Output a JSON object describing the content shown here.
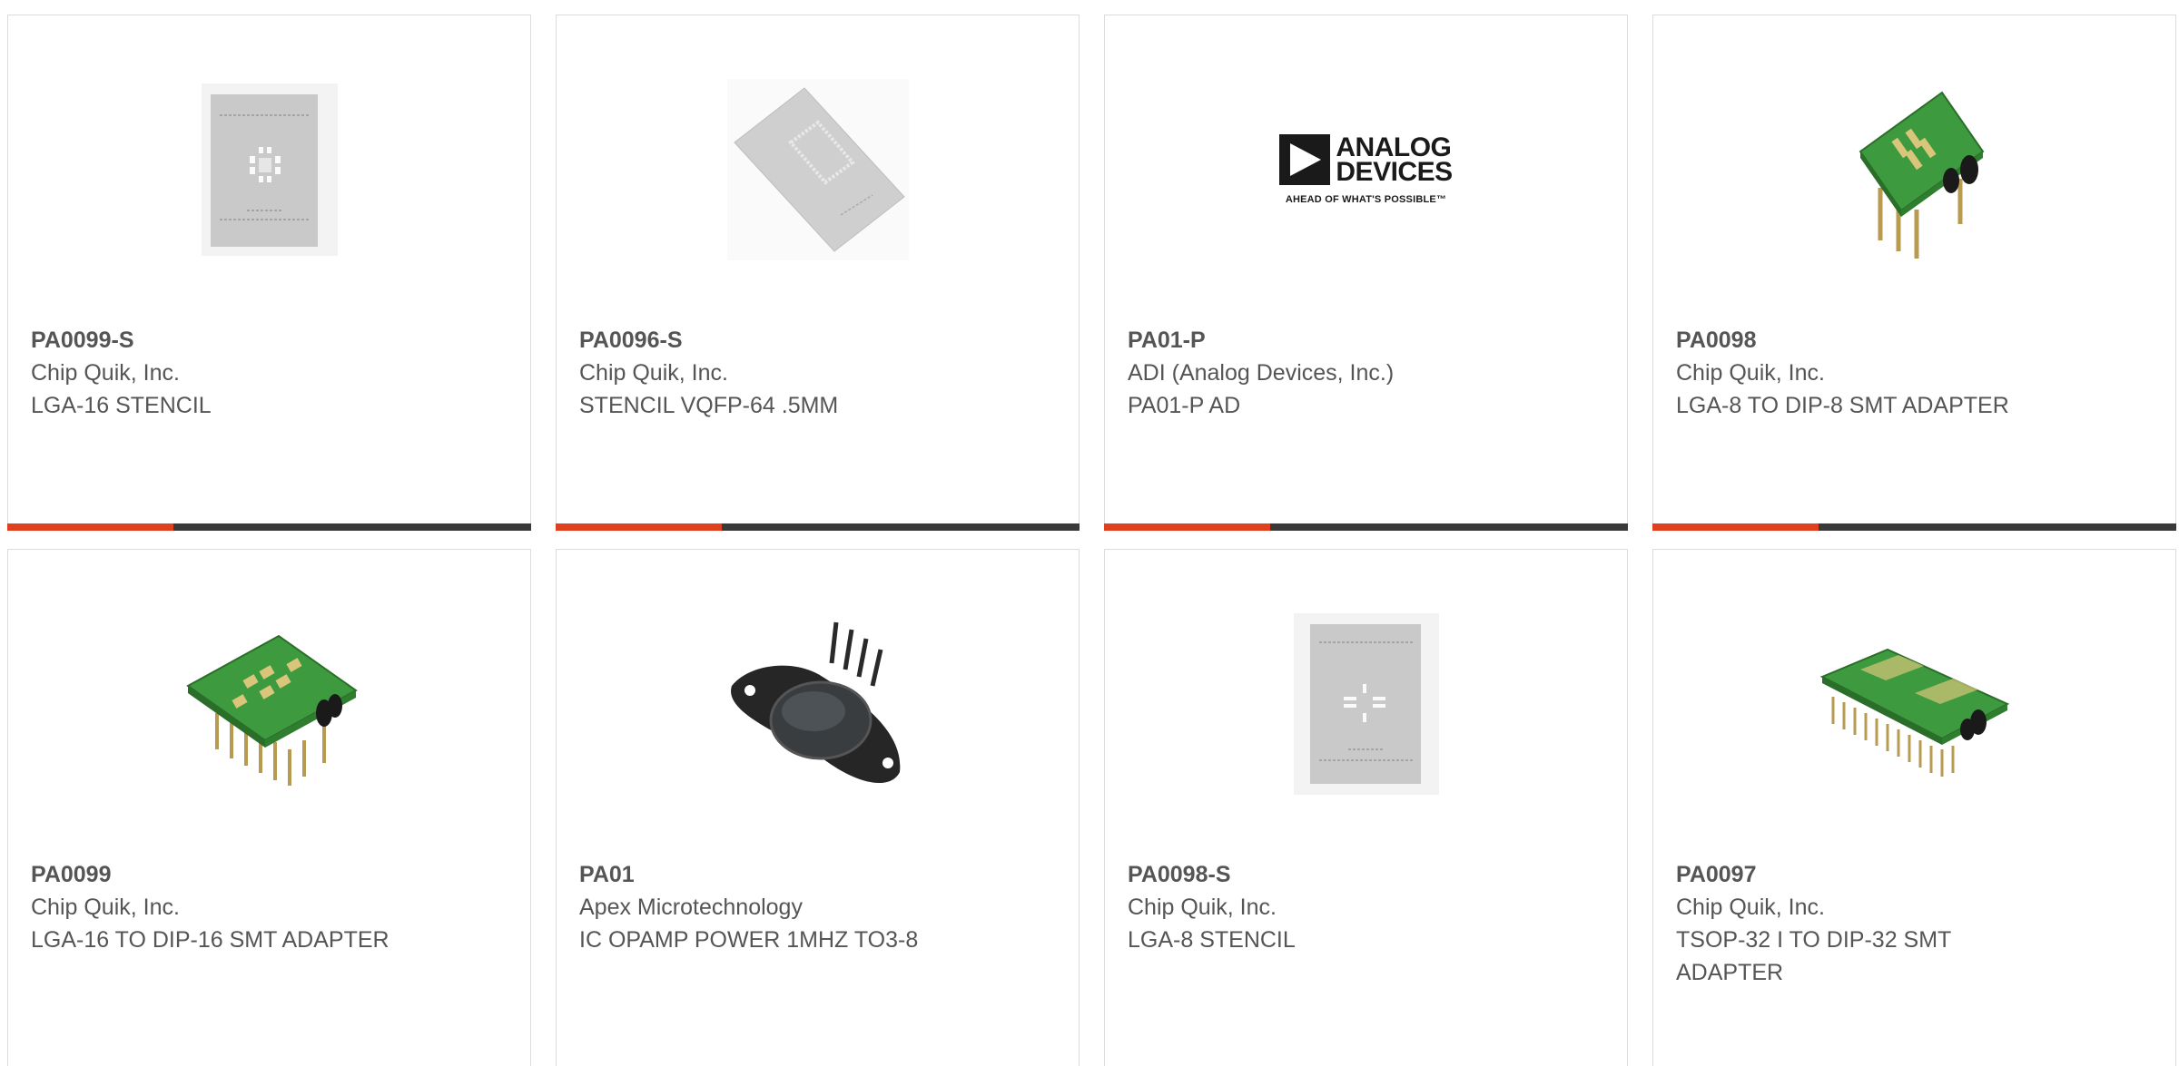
{
  "products": [
    {
      "part": "PA0099-S",
      "mfr": "Chip Quik, Inc.",
      "desc": "LGA-16 STENCIL",
      "image": "stencil-lga16-icon"
    },
    {
      "part": "PA0096-S",
      "mfr": "Chip Quik, Inc.",
      "desc": "STENCIL VQFP-64 .5MM",
      "image": "stencil-vqfp64-icon"
    },
    {
      "part": "PA01-P",
      "mfr": "ADI (Analog Devices, Inc.)",
      "desc": "PA01-P AD",
      "image": "analog-devices-logo",
      "logo": {
        "line1": "ANALOG",
        "line2": "DEVICES",
        "tagline": "AHEAD OF WHAT'S POSSIBLE™"
      }
    },
    {
      "part": "PA0098",
      "mfr": "Chip Quik, Inc.",
      "desc": "LGA-8 TO DIP-8 SMT ADAPTER",
      "image": "adapter-dip8-icon"
    },
    {
      "part": "PA0099",
      "mfr": "Chip Quik, Inc.",
      "desc": "LGA-16 TO DIP-16 SMT ADAPTER",
      "image": "adapter-dip16-icon"
    },
    {
      "part": "PA01",
      "mfr": "Apex Microtechnology",
      "desc": "IC OPAMP POWER 1MHZ TO3-8",
      "image": "to3-opamp-icon"
    },
    {
      "part": "PA0098-S",
      "mfr": "Chip Quik, Inc.",
      "desc": "LGA-8 STENCIL",
      "image": "stencil-lga8-icon"
    },
    {
      "part": "PA0097",
      "mfr": "Chip Quik, Inc.",
      "desc": "TSOP-32 I TO DIP-32 SMT ADAPTER",
      "image": "adapter-dip32-icon"
    }
  ],
  "colors": {
    "accent": "#e1401f",
    "bar": "#3a3a3a",
    "text": "#555555",
    "border": "#dcdcdc"
  }
}
